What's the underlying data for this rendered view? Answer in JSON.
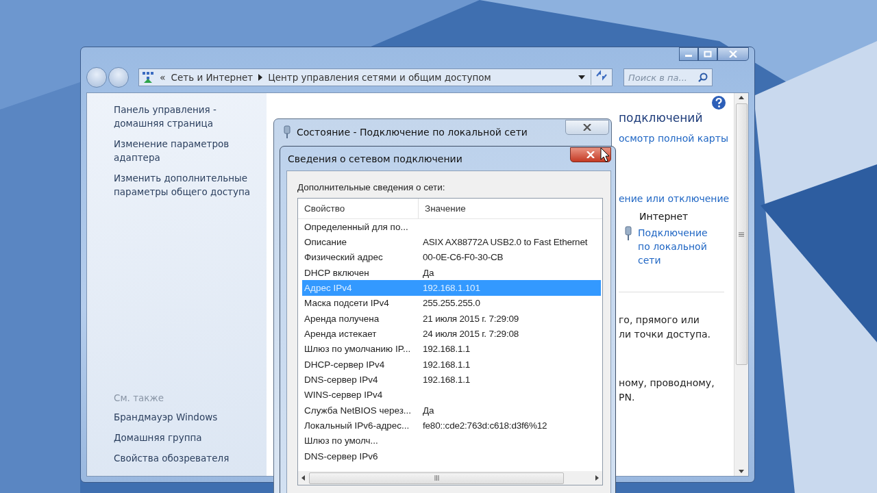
{
  "main_window": {
    "address_chevron": "«",
    "breadcrumb": [
      "Сеть и Интернет",
      "Центр управления сетями и общим доступом"
    ],
    "search": {
      "placeholder": "Поиск в па..."
    },
    "sidebar": {
      "links": [
        "Панель управления - домашняя страница",
        "Изменение параметров адаптера",
        "Изменить дополнительные параметры общего доступа"
      ],
      "see_also_title": "См. также",
      "see_also": [
        "Брандмауэр Windows",
        "Домашняя группа",
        "Свойства обозревателя"
      ]
    },
    "content": {
      "heading": "подключений",
      "map_link": "осмотр полной карты",
      "connect_link": "ение или отключение",
      "network_type": "Интернет",
      "connection_link": "Подключение по локальной сети",
      "paragraphs": [
        [
          "го, прямого или",
          "ли точки доступа."
        ],
        [
          "ному, проводному,",
          "PN."
        ]
      ]
    }
  },
  "status_dialog": {
    "title": "Состояние - Подключение по локальной сети"
  },
  "details_dialog": {
    "title": "Сведения о сетевом подключении",
    "label": "Дополнительные сведения о сети:",
    "columns": [
      "Свойство",
      "Значение"
    ],
    "rows": [
      {
        "property": "Определенный для по...",
        "selected": false
      },
      {
        "property": "Описание",
        "value": "ASIX AX88772A USB2.0 to Fast Ethernet",
        "selected": false
      },
      {
        "property": "Физический адрес",
        "value": "00-0E-C6-F0-30-CB",
        "selected": false
      },
      {
        "property": "DHCP включен",
        "value": "Да",
        "selected": false
      },
      {
        "property": "Адрес IPv4",
        "value": "192.168.1.101",
        "selected": true
      },
      {
        "property": "Маска подсети IPv4",
        "value": "255.255.255.0",
        "selected": false
      },
      {
        "property": "Аренда получена",
        "value": "21 июля 2015 г. 7:29:09",
        "selected": false
      },
      {
        "property": "Аренда истекает",
        "value": "24 июля 2015 г. 7:29:08",
        "selected": false
      },
      {
        "property": "Шлюз по умолчанию IP...",
        "value": "192.168.1.1",
        "selected": false
      },
      {
        "property": "DHCP-сервер IPv4",
        "value": "192.168.1.1",
        "selected": false
      },
      {
        "property": "DNS-сервер IPv4",
        "value": "192.168.1.1",
        "selected": false
      },
      {
        "property": "WINS-сервер IPv4",
        "selected": false
      },
      {
        "property": "Служба NetBIOS через...",
        "value": "Да",
        "selected": false
      },
      {
        "property": "Локальный IPv6-адрес...",
        "value": "fe80::cde2:763d:c618:d3f6%12",
        "selected": false
      },
      {
        "property": "Шлюз по умолч...",
        "selected": false
      },
      {
        "property": "DNS-сервер IPv6",
        "selected": false
      }
    ]
  }
}
